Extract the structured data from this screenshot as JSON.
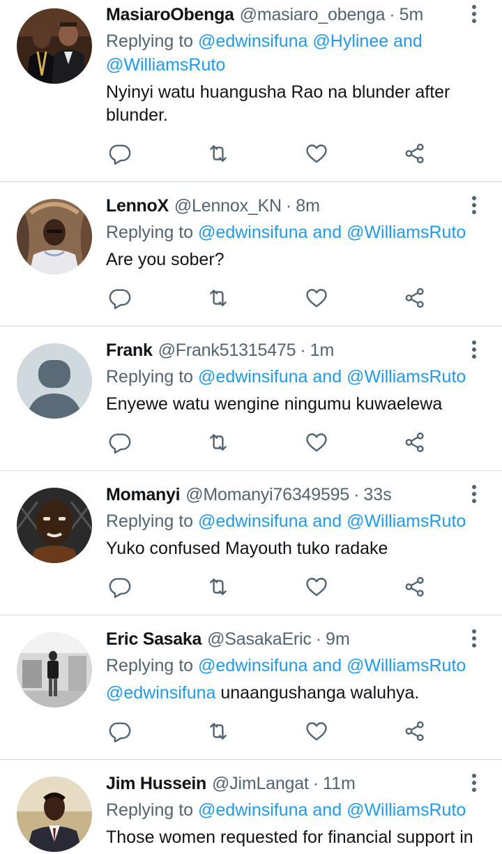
{
  "tweets": [
    {
      "name": "MasiaroObenga",
      "handle": "@masiaro_obenga",
      "dot": "·",
      "time": "5m",
      "replying_prefix": "Replying to",
      "replying_to": "@edwinsifuna @Hylinee",
      "and": "and",
      "replying_to_last": "@WilliamsRuto",
      "text": "Nyinyi watu huangusha Rao na blunder after blunder.",
      "avatar_icon": "photo-two-men"
    },
    {
      "name": "LennoX",
      "handle": "@Lennox_KN",
      "dot": "·",
      "time": "8m",
      "replying_prefix": "Replying to",
      "replying_to": "@edwinsifuna",
      "and": "and",
      "replying_to_last": "@WilliamsRuto",
      "text": "Are you sober?",
      "avatar_icon": "photo-man-cave"
    },
    {
      "name": "Frank",
      "handle": "@Frank51315475",
      "dot": "·",
      "time": "1m",
      "replying_prefix": "Replying to",
      "replying_to": "@edwinsifuna",
      "and": "and",
      "replying_to_last": "@WilliamsRuto",
      "text": "Enyewe watu wengine ningumu kuwaelewa",
      "avatar_icon": "default-user-icon"
    },
    {
      "name": "Momanyi",
      "handle": "@Momanyi76349595",
      "dot": "·",
      "time": "33s",
      "replying_prefix": "Replying to",
      "replying_to": "@edwinsifuna",
      "and": "and",
      "replying_to_last": "@WilliamsRuto",
      "text": "Yuko confused Mayouth tuko radake",
      "avatar_icon": "photo-man-closeup"
    },
    {
      "name": "Eric Sasaka",
      "handle": "@SasakaEric",
      "dot": "·",
      "time": "9m",
      "replying_prefix": "Replying to",
      "replying_to": "@edwinsifuna",
      "and": "and",
      "replying_to_last": "@WilliamsRuto",
      "text_mention": "@edwinsifuna",
      "text": " unaangushanga waluhya.",
      "avatar_icon": "photo-man-room-bw"
    },
    {
      "name": "Jim Hussein",
      "handle": "@JimLangat",
      "dot": "·",
      "time": "11m",
      "replying_prefix": "Replying to",
      "replying_to": "@edwinsifuna",
      "and": "and",
      "replying_to_last": "@WilliamsRuto",
      "text": "Those women requested for financial support in",
      "avatar_icon": "photo-young-man-suit"
    }
  ],
  "actions": [
    "reply-icon",
    "retweet-icon",
    "like-icon",
    "share-icon"
  ],
  "colors": {
    "link": "#1d9bf0",
    "secondary": "#536471",
    "primary_text": "#0f1419",
    "divider": "#cfd9de"
  }
}
